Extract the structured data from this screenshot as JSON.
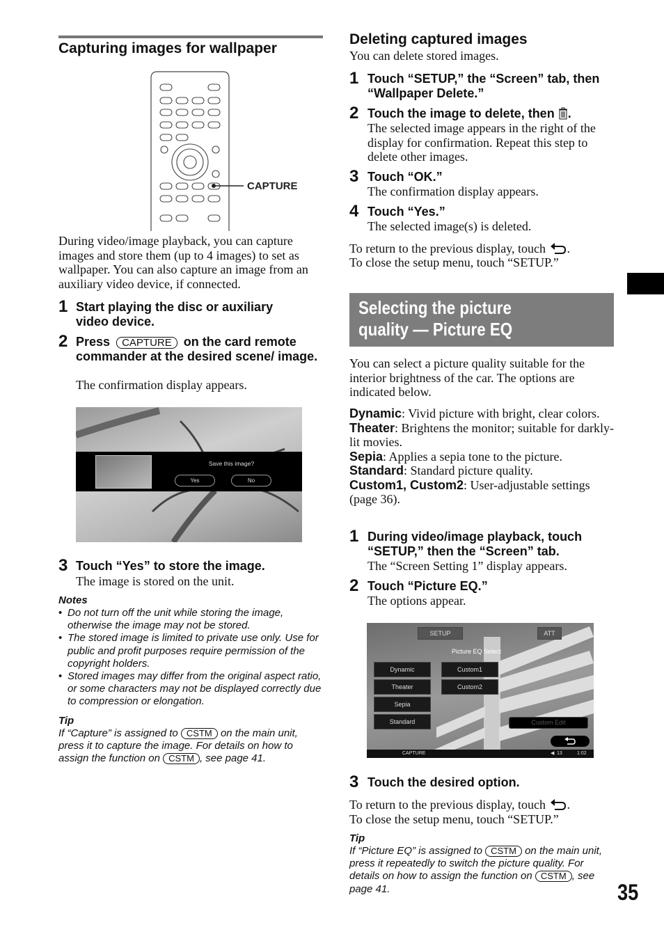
{
  "left": {
    "title": "Capturing images for wallpaper",
    "capture_label": "CAPTURE",
    "intro": "During video/image playback, you can capture images and store them (up to 4 images) to set as wallpaper. You can also capture an image from an auxiliary video device, if connected.",
    "steps": [
      {
        "num": "1",
        "title": "Start playing the disc or auxiliary video device."
      },
      {
        "num": "2",
        "title_pre": "Press",
        "key": "CAPTURE",
        "title_post": "on the card remote commander at the desired scene/ image.",
        "body": "The confirmation display appears."
      },
      {
        "num": "3",
        "title": "Touch “Yes” to store the image.",
        "body": "The image is stored on the unit."
      }
    ],
    "dialog": {
      "question": "Save this image?",
      "yes": "Yes",
      "no": "No"
    },
    "notes_title": "Notes",
    "notes": [
      "Do not turn off the unit while storing the image, otherwise the image may not be stored.",
      "The stored image is limited to private use only. Use for public and profit purposes require permission of the copyright holders.",
      "Stored images may differ from the original aspect ratio, or some characters may not be displayed correctly due to compression or elongation."
    ],
    "tip_title": "Tip",
    "tip": {
      "p1": "If “Capture” is assigned to",
      "key": "CSTM",
      "p2": "on the main unit, press it to capture the image. For details on how to assign the function on",
      "p3": ", see page 41."
    }
  },
  "right": {
    "delete_title": "Deleting captured images",
    "delete_intro": "You can delete stored images.",
    "delete_steps": [
      {
        "num": "1",
        "title": "Touch “SETUP,” the “Screen” tab, then “Wallpaper Delete.”"
      },
      {
        "num": "2",
        "title": "Touch the image to delete, then",
        "title_end": ".",
        "body": "The selected image appears in the right of the display for confirmation. Repeat this step to delete other images."
      },
      {
        "num": "3",
        "title": "Touch “OK.”",
        "body": "The confirmation display appears."
      },
      {
        "num": "4",
        "title": "Touch “Yes.”",
        "body": "The selected image(s) is deleted."
      }
    ],
    "return_text": "To return to the previous display, touch",
    "close_text": "To close the setup menu, touch “SETUP.”",
    "band_title": "Selecting the picture quality — Picture EQ",
    "eq_intro": "You can select a picture quality suitable for the interior brightness of the car. The options are indicated below.",
    "options": [
      {
        "term": "Dynamic",
        "desc": ": Vivid picture with bright, clear colors."
      },
      {
        "term": "Theater",
        "desc": ": Brightens the monitor; suitable for darkly-lit movies."
      },
      {
        "term": "Sepia",
        "desc": ": Applies a sepia tone to the picture."
      },
      {
        "term": "Standard",
        "desc": ": Standard picture quality."
      },
      {
        "term": "Custom1, Custom2",
        "desc": ": User-adjustable settings (page 36)."
      }
    ],
    "eq_steps": [
      {
        "num": "1",
        "title": "During video/image playback, touch “SETUP,” then the “Screen” tab.",
        "body": "The “Screen Setting 1” display appears."
      },
      {
        "num": "2",
        "title": "Touch “Picture EQ.”",
        "body": "The options appear."
      },
      {
        "num": "3",
        "title": "Touch the desired option."
      }
    ],
    "screen": {
      "setup": "SETUP",
      "att": "ATT",
      "heading": "Picture EQ Select",
      "buttons": [
        "Dynamic",
        "Theater",
        "Sepia",
        "Standard",
        "Custom1",
        "Custom2"
      ],
      "custom_edit": "Custom Edit",
      "capture": "CAPTURE",
      "volume": "13",
      "time": "1:02"
    },
    "tip_title": "Tip",
    "tip": {
      "p1": "If “Picture EQ” is assigned to",
      "key": "CSTM",
      "p2": "on the main unit, press it repeatedly to switch the picture quality. For details on how to assign the function on",
      "p3": ", see page 41."
    }
  },
  "page_number": "35",
  "colors": {
    "band": "#7d7d7d",
    "rule": "#777777"
  }
}
